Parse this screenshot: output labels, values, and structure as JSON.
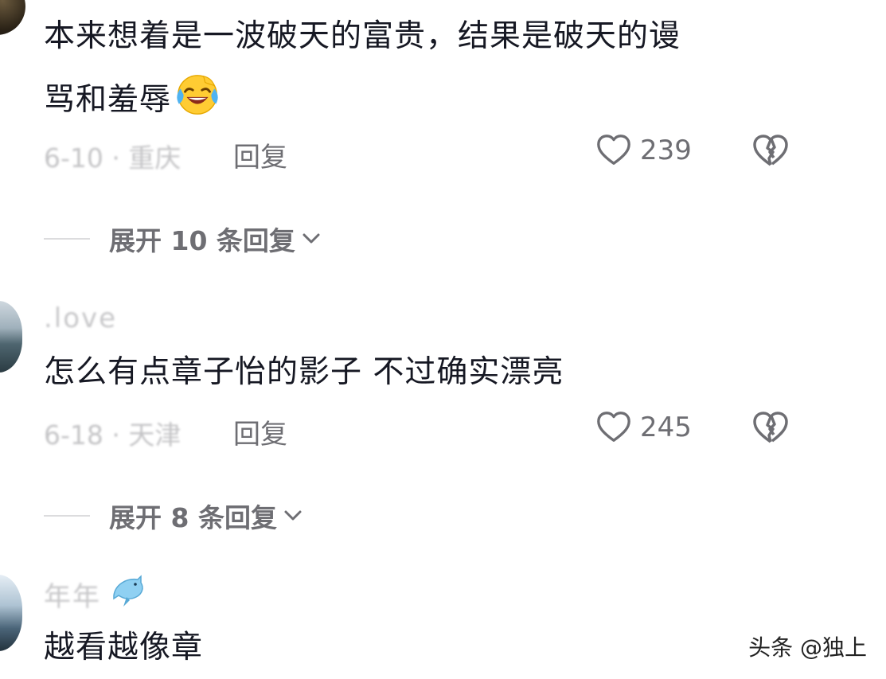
{
  "comments": [
    {
      "text_line1": "本来想着是一波破天的富贵，结果是破天的谩",
      "text_line2": "骂和羞辱",
      "emoji": "rolling-on-floor-laughing",
      "meta": "6-10 · 重庆",
      "reply_label": "回复",
      "likes": "239",
      "expand": "展开 10 条回复"
    },
    {
      "username": ".love",
      "text": "怎么有点章子怡的影子 不过确实漂亮",
      "meta": "6-18 · 天津",
      "reply_label": "回复",
      "likes": "245",
      "expand": "展开 8 条回复"
    },
    {
      "username": "年年",
      "badge_icon": "dolphin-icon",
      "text": "越看越像章"
    }
  ],
  "watermark": "头条 @独上",
  "colors": {
    "text": "#161823",
    "muted": "#6e6e73",
    "faint": "#c4c4c6"
  }
}
